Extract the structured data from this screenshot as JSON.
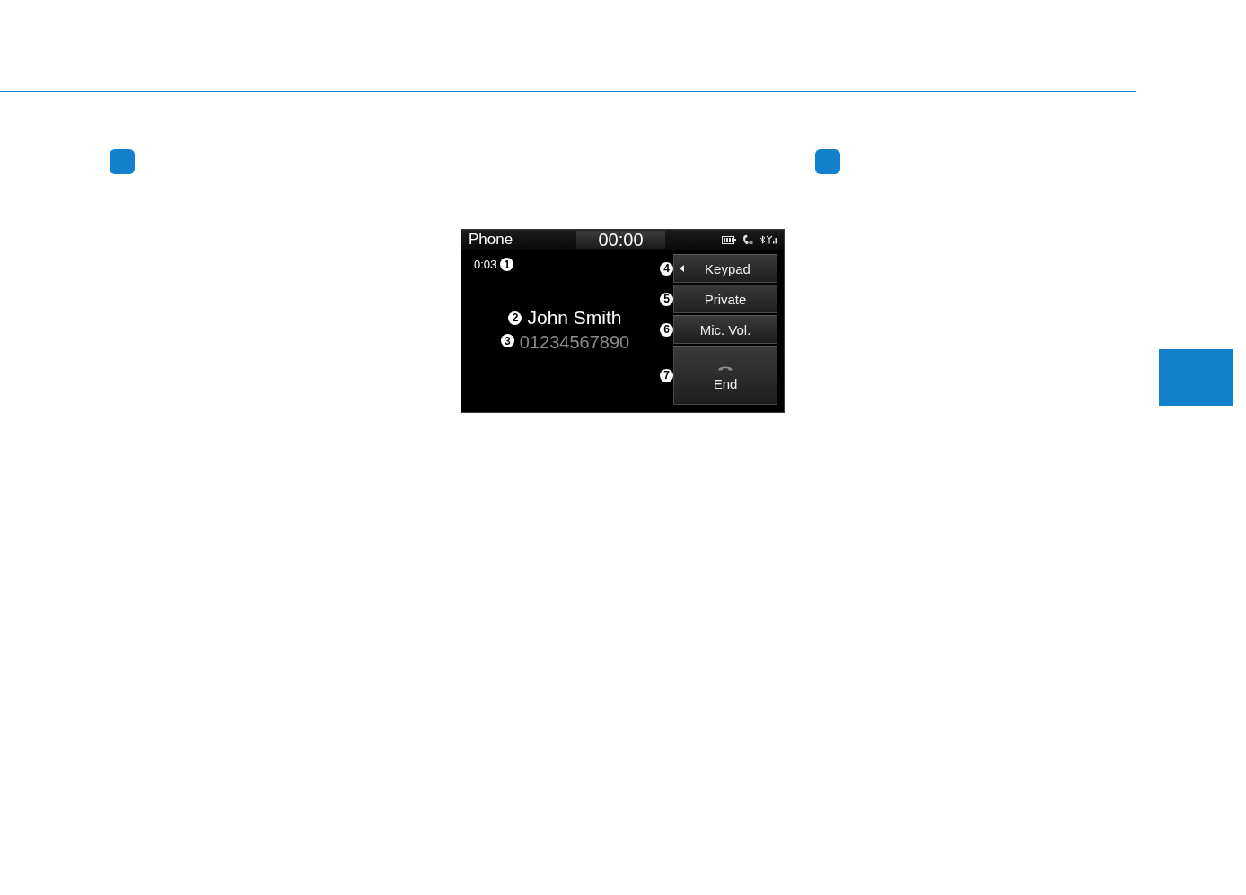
{
  "phone_screen": {
    "title": "Phone",
    "timer": "00:00",
    "call": {
      "duration": "0:03",
      "duration_callout": "1",
      "name": "John Smith",
      "name_callout": "2",
      "number": "01234567890",
      "number_callout": "3"
    },
    "buttons": [
      {
        "kind": "expand",
        "label": "Keypad",
        "callout": "4"
      },
      {
        "kind": "plain",
        "label": "Private",
        "callout": "5"
      },
      {
        "kind": "plain",
        "label": "Mic. Vol.",
        "callout": "6"
      },
      {
        "kind": "end",
        "label": "End",
        "callout": "7"
      }
    ]
  }
}
